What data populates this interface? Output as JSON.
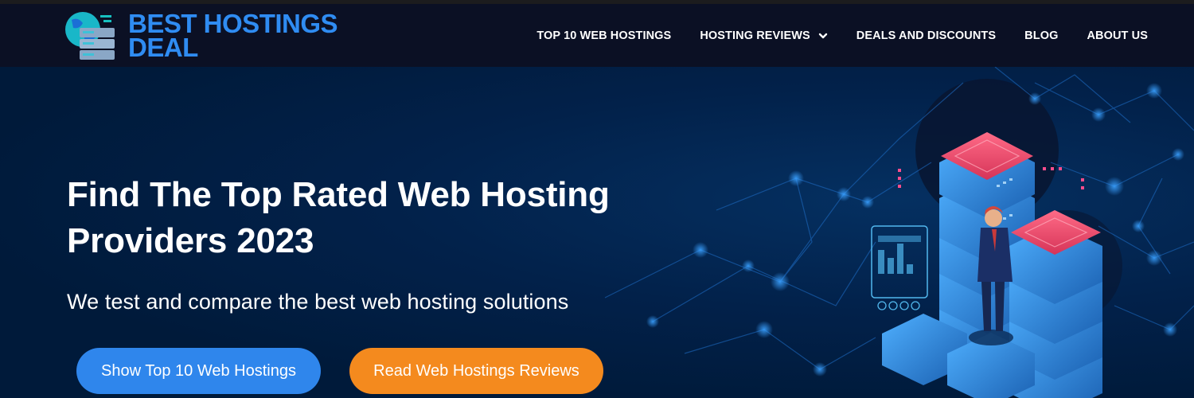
{
  "brand": {
    "line1": "BEST HOSTINGS",
    "line2": "DEAL",
    "color": "#2f8cf2"
  },
  "nav": {
    "items": [
      {
        "label": "TOP 10 WEB HOSTINGS"
      },
      {
        "label": "HOSTING REVIEWS",
        "has_dropdown": true
      },
      {
        "label": "DEALS AND DISCOUNTS"
      },
      {
        "label": "BLOG"
      },
      {
        "label": "ABOUT US"
      }
    ]
  },
  "hero": {
    "headline_line1": "Find The Top Rated Web Hosting",
    "headline_line2": "Providers 2023",
    "subheadline": "We test and compare the best web hosting solutions",
    "primary_button": "Show Top 10 Web Hostings",
    "secondary_button": "Read Web Hostings Reviews"
  },
  "colors": {
    "navbar_bg": "#0b1024",
    "hero_bg": "#001a3a",
    "primary_button": "#2f86ec",
    "secondary_button": "#f48a1e",
    "server_top": "#e8416a",
    "server_body": "#2c8fd8"
  },
  "icons": {
    "logo": "server-globe-icon",
    "dropdown": "chevron-down-icon",
    "illustration": "server-network-illustration"
  }
}
